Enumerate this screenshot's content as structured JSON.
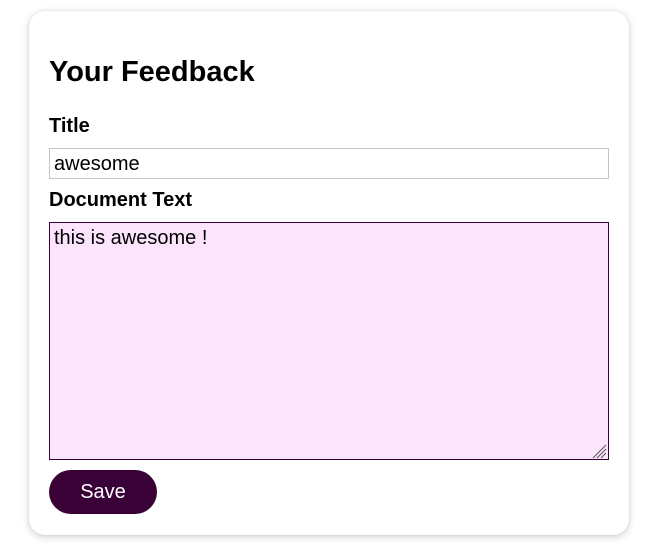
{
  "form": {
    "heading": "Your Feedback",
    "title_label": "Title",
    "title_value": "awesome",
    "document_label": "Document Text",
    "document_value": "this is awesome !",
    "save_label": "Save"
  },
  "colors": {
    "button_bg": "#3a0038",
    "textarea_bg": "#fde4fd",
    "textarea_border": "#3c003c"
  },
  "icons": {
    "resize_handle": "resize-grip-icon"
  }
}
